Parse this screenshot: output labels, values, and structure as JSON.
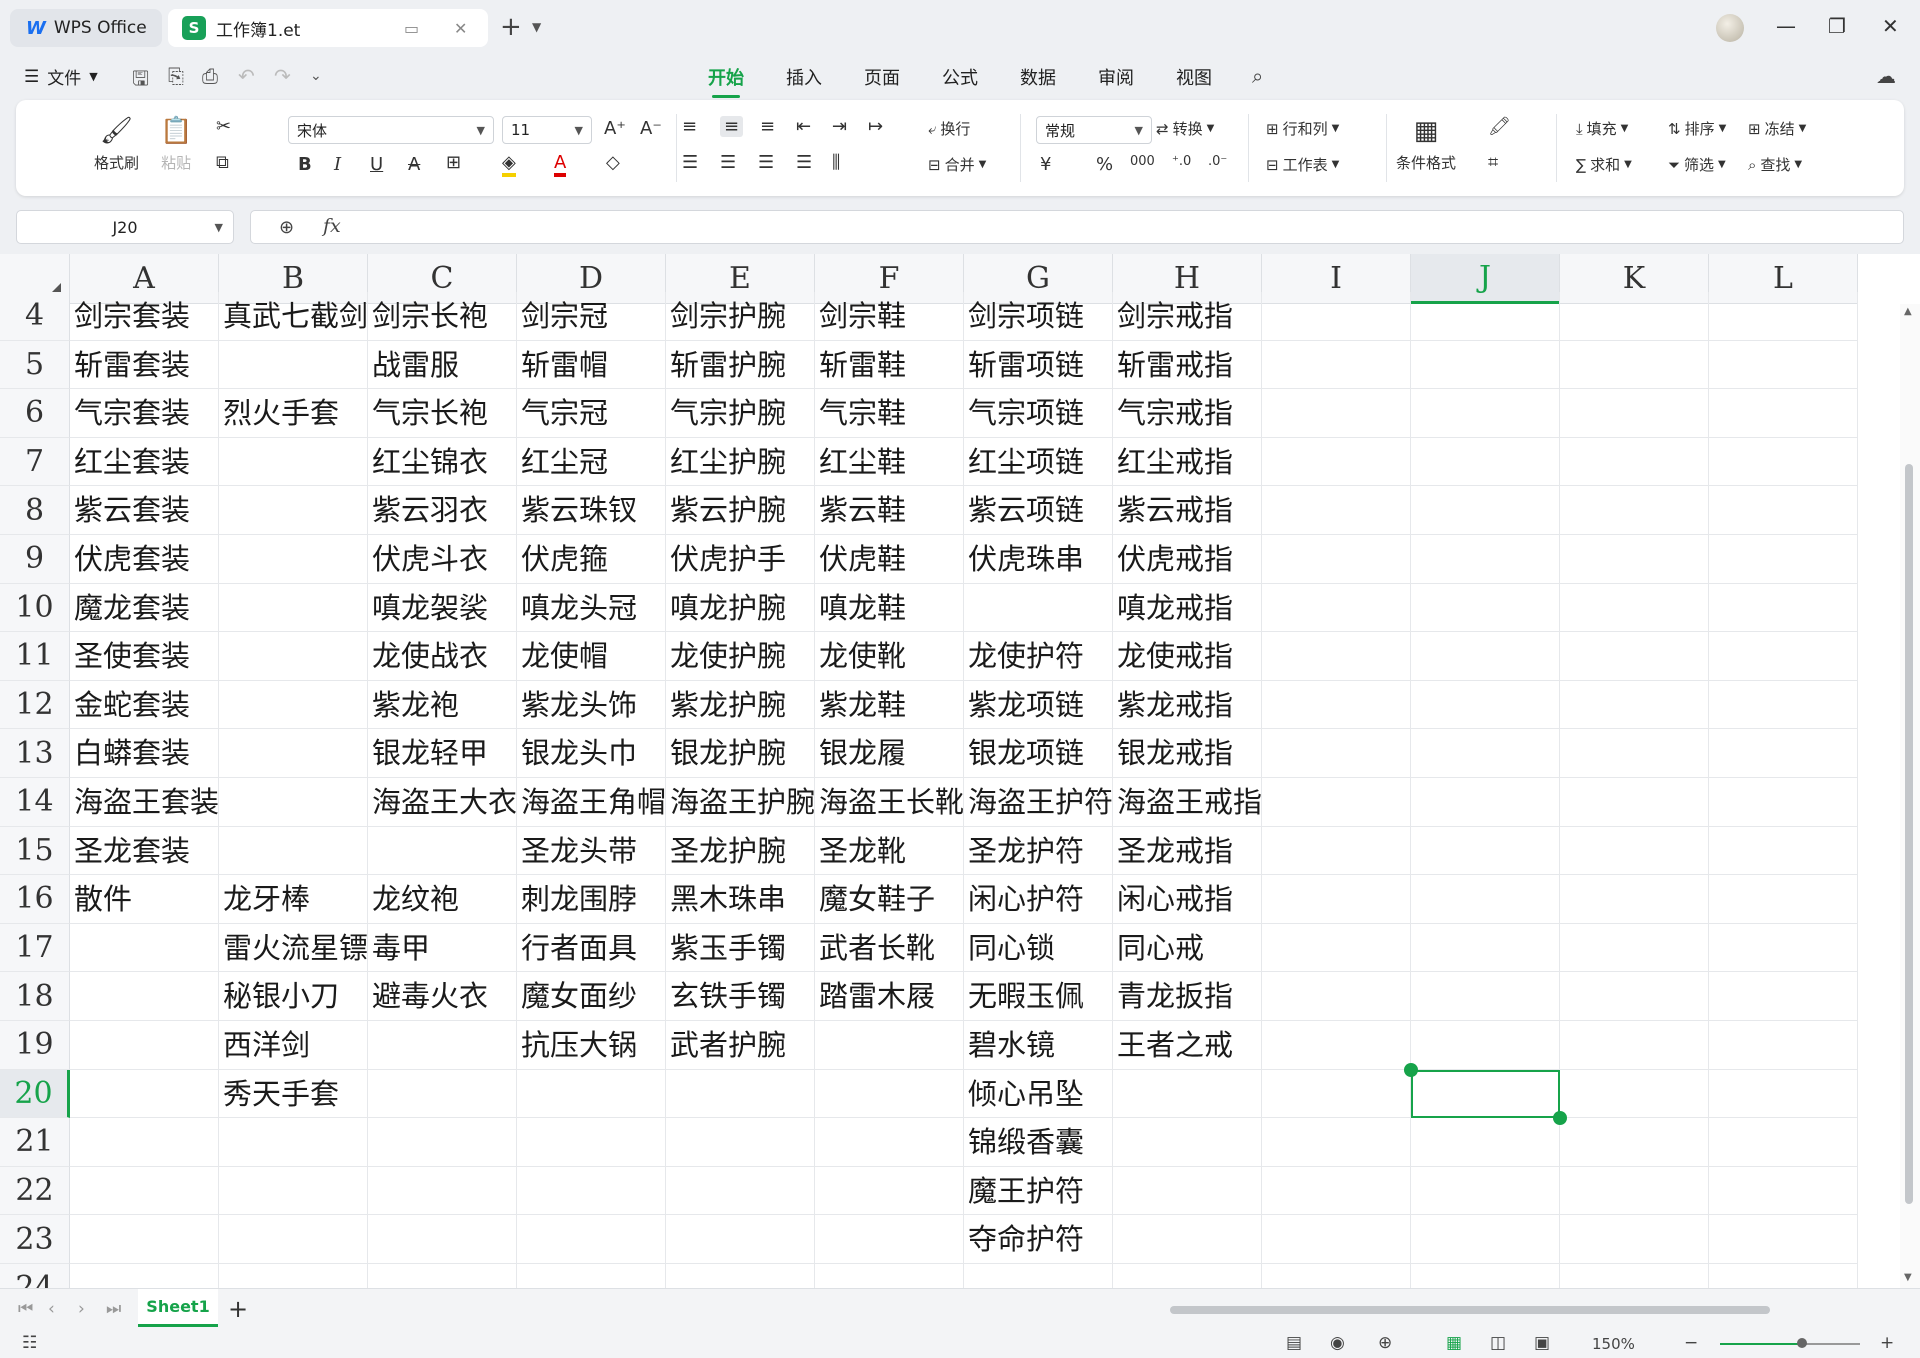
{
  "titlebar": {
    "app_tab": "WPS Office",
    "doc_tab": "工作簿1.et",
    "doc_icon_letter": "S"
  },
  "menu": {
    "file": "文件",
    "tabs": [
      "开始",
      "插入",
      "页面",
      "公式",
      "数据",
      "审阅",
      "视图"
    ],
    "active_tab": "开始"
  },
  "ribbon": {
    "format_painter": "格式刷",
    "paste": "粘贴",
    "font_name": "宋体",
    "font_size": "11",
    "wrap": "换行",
    "merge": "合并",
    "number_format": "常规",
    "convert": "转换",
    "rows_cols": "行和列",
    "worksheet": "工作表",
    "cond_format": "条件格式",
    "fill": "填充",
    "sort": "排序",
    "freeze": "冻结",
    "sum": "求和",
    "filter": "筛选",
    "find": "查找"
  },
  "formula_bar": {
    "name_box": "J20",
    "fx": "fx",
    "content": ""
  },
  "columns": [
    "A",
    "B",
    "C",
    "D",
    "E",
    "F",
    "G",
    "H",
    "I",
    "J",
    "K",
    "L"
  ],
  "selected_column": "J",
  "selected_row": "20",
  "rows": [
    {
      "n": "4",
      "cells": [
        "剑宗套装",
        "真武七截剑",
        "剑宗长袍",
        "剑宗冠",
        "剑宗护腕",
        "剑宗鞋",
        "剑宗项链",
        "剑宗戒指",
        "",
        "",
        "",
        ""
      ]
    },
    {
      "n": "5",
      "cells": [
        "斩雷套装",
        "",
        "战雷服",
        "斩雷帽",
        "斩雷护腕",
        "斩雷鞋",
        "斩雷项链",
        "斩雷戒指",
        "",
        "",
        "",
        ""
      ]
    },
    {
      "n": "6",
      "cells": [
        "气宗套装",
        "烈火手套",
        "气宗长袍",
        "气宗冠",
        "气宗护腕",
        "气宗鞋",
        "气宗项链",
        "气宗戒指",
        "",
        "",
        "",
        ""
      ]
    },
    {
      "n": "7",
      "cells": [
        "红尘套装",
        "",
        "红尘锦衣",
        "红尘冠",
        "红尘护腕",
        "红尘鞋",
        "红尘项链",
        "红尘戒指",
        "",
        "",
        "",
        ""
      ]
    },
    {
      "n": "8",
      "cells": [
        "紫云套装",
        "",
        "紫云羽衣",
        "紫云珠钗",
        "紫云护腕",
        "紫云鞋",
        "紫云项链",
        "紫云戒指",
        "",
        "",
        "",
        ""
      ]
    },
    {
      "n": "9",
      "cells": [
        "伏虎套装",
        "",
        "伏虎斗衣",
        "伏虎箍",
        "伏虎护手",
        "伏虎鞋",
        "伏虎珠串",
        "伏虎戒指",
        "",
        "",
        "",
        ""
      ]
    },
    {
      "n": "10",
      "cells": [
        "魔龙套装",
        "",
        "嗔龙袈裟",
        "嗔龙头冠",
        "嗔龙护腕",
        "嗔龙鞋",
        "",
        "嗔龙戒指",
        "",
        "",
        "",
        ""
      ]
    },
    {
      "n": "11",
      "cells": [
        "圣使套装",
        "",
        "龙使战衣",
        "龙使帽",
        "龙使护腕",
        "龙使靴",
        "龙使护符",
        "龙使戒指",
        "",
        "",
        "",
        ""
      ]
    },
    {
      "n": "12",
      "cells": [
        "金蛇套装",
        "",
        "紫龙袍",
        "紫龙头饰",
        "紫龙护腕",
        "紫龙鞋",
        "紫龙项链",
        "紫龙戒指",
        "",
        "",
        "",
        ""
      ]
    },
    {
      "n": "13",
      "cells": [
        "白蟒套装",
        "",
        "银龙轻甲",
        "银龙头巾",
        "银龙护腕",
        "银龙履",
        "银龙项链",
        "银龙戒指",
        "",
        "",
        "",
        ""
      ]
    },
    {
      "n": "14",
      "cells": [
        "海盗王套装",
        "",
        "海盗王大衣",
        "海盗王角帽",
        "海盗王护腕",
        "海盗王长靴",
        "海盗王护符",
        "海盗王戒指",
        "",
        "",
        "",
        ""
      ]
    },
    {
      "n": "15",
      "cells": [
        "圣龙套装",
        "",
        "",
        "圣龙头带",
        "圣龙护腕",
        "圣龙靴",
        "圣龙护符",
        "圣龙戒指",
        "",
        "",
        "",
        ""
      ]
    },
    {
      "n": "16",
      "cells": [
        "散件",
        "龙牙棒",
        "龙纹袍",
        "刺龙围脖",
        "黑木珠串",
        "魔女鞋子",
        "闲心护符",
        "闲心戒指",
        "",
        "",
        "",
        ""
      ]
    },
    {
      "n": "17",
      "cells": [
        "",
        "雷火流星镖",
        "毒甲",
        "行者面具",
        "紫玉手镯",
        "武者长靴",
        "同心锁",
        "同心戒",
        "",
        "",
        "",
        ""
      ]
    },
    {
      "n": "18",
      "cells": [
        "",
        "秘银小刀",
        "避毒火衣",
        "魔女面纱",
        "玄铁手镯",
        "踏雷木屐",
        "无暇玉佩",
        "青龙扳指",
        "",
        "",
        "",
        ""
      ]
    },
    {
      "n": "19",
      "cells": [
        "",
        "西洋剑",
        "",
        "抗压大锅",
        "武者护腕",
        "",
        "碧水镜",
        "王者之戒",
        "",
        "",
        "",
        ""
      ]
    },
    {
      "n": "20",
      "cells": [
        "",
        "秀天手套",
        "",
        "",
        "",
        "",
        "倾心吊坠",
        "",
        "",
        "",
        "",
        ""
      ]
    },
    {
      "n": "21",
      "cells": [
        "",
        "",
        "",
        "",
        "",
        "",
        "锦缎香囊",
        "",
        "",
        "",
        "",
        ""
      ]
    },
    {
      "n": "22",
      "cells": [
        "",
        "",
        "",
        "",
        "",
        "",
        "魔王护符",
        "",
        "",
        "",
        "",
        ""
      ]
    },
    {
      "n": "23",
      "cells": [
        "",
        "",
        "",
        "",
        "",
        "",
        "夺命护符",
        "",
        "",
        "",
        "",
        ""
      ]
    },
    {
      "n": "24",
      "cells": [
        "",
        "",
        "",
        "",
        "",
        "",
        "",
        "",
        "",
        "",
        "",
        ""
      ]
    }
  ],
  "sheet_tabs": [
    "Sheet1"
  ],
  "status": {
    "zoom": "150%"
  },
  "colors": {
    "accent": "#16a34a",
    "wps_blue": "#1a6ff0"
  }
}
